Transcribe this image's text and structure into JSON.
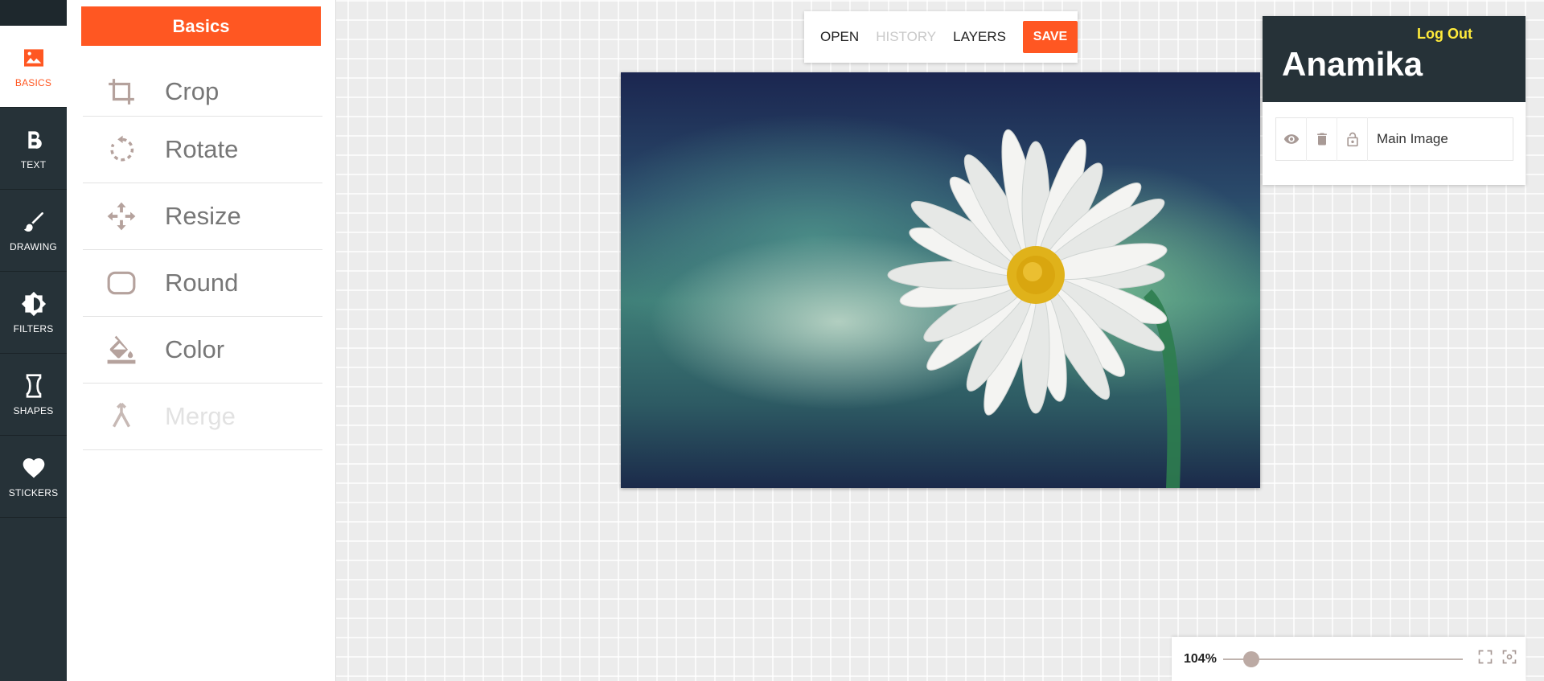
{
  "sidebar": {
    "items": [
      {
        "label": "BASICS",
        "icon": "image-icon",
        "active": true
      },
      {
        "label": "TEXT",
        "icon": "bold-icon"
      },
      {
        "label": "DRAWING",
        "icon": "brush-icon"
      },
      {
        "label": "FILTERS",
        "icon": "brightness-icon"
      },
      {
        "label": "SHAPES",
        "icon": "hourglass-shape-icon"
      },
      {
        "label": "STICKERS",
        "icon": "heart-icon"
      }
    ]
  },
  "panel": {
    "title": "Basics",
    "tools": [
      {
        "label": "Crop",
        "icon": "crop-icon"
      },
      {
        "label": "Rotate",
        "icon": "rotate-icon"
      },
      {
        "label": "Resize",
        "icon": "move-icon"
      },
      {
        "label": "Round",
        "icon": "rounded-rect-icon"
      },
      {
        "label": "Color",
        "icon": "fill-bucket-icon"
      },
      {
        "label": "Merge",
        "icon": "merge-icon",
        "disabled": true
      }
    ]
  },
  "toolbar": {
    "open": "OPEN",
    "history": "HISTORY",
    "layers": "LAYERS",
    "save": "SAVE"
  },
  "user": {
    "logout": "Log Out",
    "name": "Anamika"
  },
  "layers": [
    {
      "name": "Main Image"
    }
  ],
  "zoom": {
    "label": "104%",
    "level": 0.09
  },
  "colors": {
    "accent": "#ff5722",
    "dark": "#263238",
    "logout": "#ffeb3b",
    "icon": "#bcaaa4"
  }
}
